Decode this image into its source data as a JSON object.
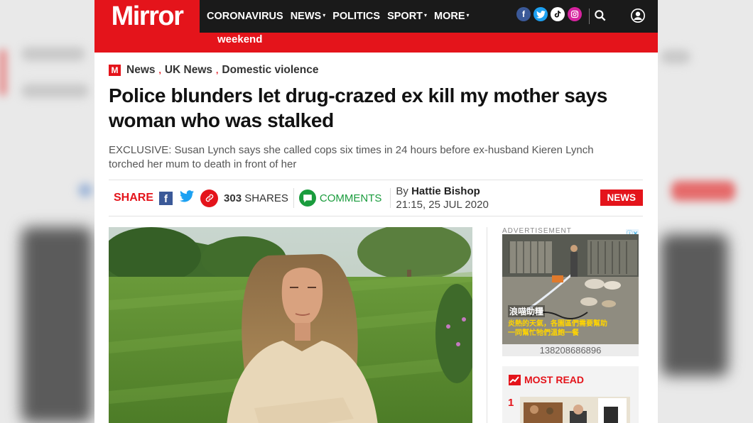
{
  "site": {
    "logo": "Mirror",
    "nav": [
      {
        "label": "CORONAVIRUS",
        "caret": false
      },
      {
        "label": "NEWS",
        "caret": true
      },
      {
        "label": "POLITICS",
        "caret": false
      },
      {
        "label": "SPORT",
        "caret": true
      },
      {
        "label": "MORE",
        "caret": true
      }
    ],
    "subbar_text": "weekend",
    "brand_color": "#e4141b"
  },
  "breadcrumb": {
    "items": [
      "News",
      "UK News",
      "Domestic violence"
    ],
    "separator": ","
  },
  "article": {
    "headline": "Police blunders let drug-crazed ex kill my mother says woman who was stalked",
    "standfirst": "EXCLUSIVE: Susan Lynch says she called cops six times in 24 hours before ex-husband Kieren Lynch torched her mum to death in front of her",
    "share_label": "SHARE",
    "share_count": "303",
    "shares_word": "SHARES",
    "comments_label": "COMMENTS",
    "by_prefix": "By",
    "author": "Hattie Bishop",
    "timestamp": "21:15, 25 JUL 2020",
    "section_badge": "NEWS"
  },
  "ad": {
    "label": "ADVERTISEMENT",
    "close": "ⓘ✕",
    "caption_1": "浪喵助糧",
    "caption_2": "炎熱的天氣，各園區們需要幫助",
    "caption_3": "一同幫忙牠們溫飽一餐",
    "phone": "138208686896"
  },
  "most_read": {
    "title": "MOST READ",
    "first_rank": "1"
  },
  "icons": {
    "facebook": "facebook-icon",
    "twitter": "twitter-icon",
    "tiktok": "tiktok-icon",
    "instagram": "instagram-icon",
    "search": "search-icon",
    "user": "user-icon"
  }
}
